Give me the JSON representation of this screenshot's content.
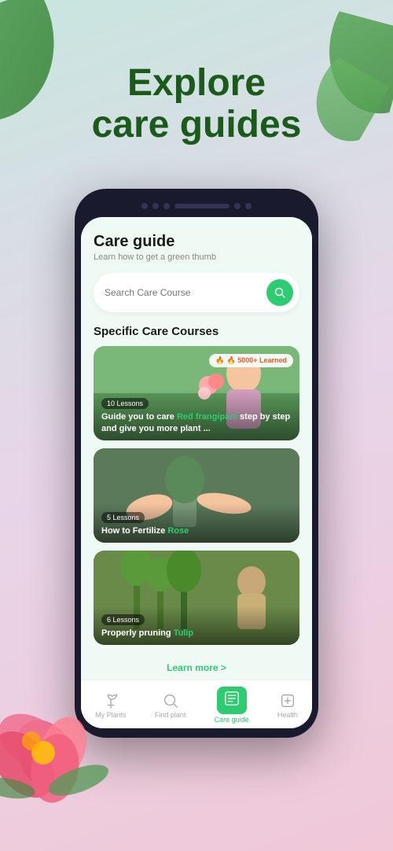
{
  "page": {
    "title_line1": "Explore",
    "title_line2": "care guides"
  },
  "screen": {
    "header": {
      "title": "Care guide",
      "subtitle": "Learn how to get a green thumb"
    },
    "search": {
      "placeholder": "Search Care Course"
    },
    "section_title": "Specific Care Courses",
    "courses": [
      {
        "id": 1,
        "lessons": "10 Lessons",
        "description_main": "Guide you to care ",
        "highlight": "Red frangipani",
        "description_end": " step by step and give you more plant ...",
        "hot_badge": "🔥 5000+ Learned",
        "has_hot": true
      },
      {
        "id": 2,
        "lessons": "5 Lessons",
        "description_main": "How to Fertilize ",
        "highlight": "Rose",
        "description_end": "",
        "has_hot": false
      },
      {
        "id": 3,
        "lessons": "6 Lessons",
        "description_main": "Properly pruning ",
        "highlight": "Tulip",
        "description_end": "",
        "has_hot": false
      }
    ],
    "learn_more": "Learn more  >",
    "nav": {
      "items": [
        {
          "label": "My Plants",
          "active": false
        },
        {
          "label": "Find plant",
          "active": false
        },
        {
          "label": "Care guide",
          "active": true
        },
        {
          "label": "Health",
          "active": false
        }
      ]
    }
  }
}
